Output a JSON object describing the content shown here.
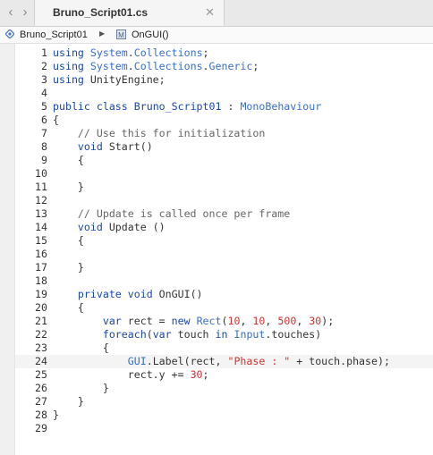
{
  "tab": {
    "title": "Bruno_Script01.cs"
  },
  "jumpbar": {
    "file": "Bruno_Script01",
    "method": "OnGUI()",
    "method_icon": "M"
  },
  "icons": {
    "back": "‹",
    "forward": "›",
    "close": "✕",
    "arrow": "▶"
  },
  "current_line": 24,
  "lines": [
    {
      "n": "1",
      "t": [
        [
          "kw",
          "using"
        ],
        [
          "p",
          " "
        ],
        [
          "typ",
          "System"
        ],
        [
          "p",
          "."
        ],
        [
          "typ",
          "Collections"
        ],
        [
          "p",
          ";"
        ]
      ]
    },
    {
      "n": "2",
      "t": [
        [
          "kw",
          "using"
        ],
        [
          "p",
          " "
        ],
        [
          "typ",
          "System"
        ],
        [
          "p",
          "."
        ],
        [
          "typ",
          "Collections"
        ],
        [
          "p",
          "."
        ],
        [
          "typ",
          "Generic"
        ],
        [
          "p",
          ";"
        ]
      ]
    },
    {
      "n": "3",
      "t": [
        [
          "kw",
          "using"
        ],
        [
          "p",
          " UnityEngine;"
        ]
      ]
    },
    {
      "n": "4",
      "t": []
    },
    {
      "n": "5",
      "t": [
        [
          "kw",
          "public class"
        ],
        [
          "p",
          " "
        ],
        [
          "kw",
          "Bruno_Script01"
        ],
        [
          "p",
          " : "
        ],
        [
          "typ",
          "MonoBehaviour"
        ]
      ]
    },
    {
      "n": "6",
      "t": [
        [
          "p",
          "{"
        ]
      ]
    },
    {
      "n": "7",
      "t": [
        [
          "p",
          "    "
        ],
        [
          "cmt",
          "// Use this for initialization"
        ]
      ]
    },
    {
      "n": "8",
      "t": [
        [
          "p",
          "    "
        ],
        [
          "kw",
          "void"
        ],
        [
          "p",
          " Start()"
        ]
      ]
    },
    {
      "n": "9",
      "t": [
        [
          "p",
          "    {"
        ]
      ]
    },
    {
      "n": "10",
      "t": []
    },
    {
      "n": "11",
      "t": [
        [
          "p",
          "    }"
        ]
      ]
    },
    {
      "n": "12",
      "t": []
    },
    {
      "n": "13",
      "t": [
        [
          "p",
          "    "
        ],
        [
          "cmt",
          "// Update is called once per frame"
        ]
      ]
    },
    {
      "n": "14",
      "t": [
        [
          "p",
          "    "
        ],
        [
          "kw",
          "void"
        ],
        [
          "p",
          " Update ()"
        ]
      ]
    },
    {
      "n": "15",
      "t": [
        [
          "p",
          "    {"
        ]
      ]
    },
    {
      "n": "16",
      "t": []
    },
    {
      "n": "17",
      "t": [
        [
          "p",
          "    }"
        ]
      ]
    },
    {
      "n": "18",
      "t": []
    },
    {
      "n": "19",
      "t": [
        [
          "p",
          "    "
        ],
        [
          "kw",
          "private void"
        ],
        [
          "p",
          " OnGUI()"
        ]
      ]
    },
    {
      "n": "20",
      "t": [
        [
          "p",
          "    {"
        ]
      ]
    },
    {
      "n": "21",
      "t": [
        [
          "p",
          "        "
        ],
        [
          "kw",
          "var"
        ],
        [
          "p",
          " rect = "
        ],
        [
          "kw",
          "new"
        ],
        [
          "p",
          " "
        ],
        [
          "typ",
          "Rect"
        ],
        [
          "p",
          "("
        ],
        [
          "num",
          "10"
        ],
        [
          "p",
          ", "
        ],
        [
          "num",
          "10"
        ],
        [
          "p",
          ", "
        ],
        [
          "num",
          "500"
        ],
        [
          "p",
          ", "
        ],
        [
          "num",
          "30"
        ],
        [
          "p",
          ");"
        ]
      ]
    },
    {
      "n": "22",
      "t": [
        [
          "p",
          "        "
        ],
        [
          "kw",
          "foreach"
        ],
        [
          "p",
          "("
        ],
        [
          "kw",
          "var"
        ],
        [
          "p",
          " touch "
        ],
        [
          "kw",
          "in"
        ],
        [
          "p",
          " "
        ],
        [
          "typ",
          "Input"
        ],
        [
          "p",
          ".touches)"
        ]
      ]
    },
    {
      "n": "23",
      "t": [
        [
          "p",
          "        {"
        ]
      ]
    },
    {
      "n": "24",
      "t": [
        [
          "p",
          "            "
        ],
        [
          "typ",
          "GUI"
        ],
        [
          "p",
          ".Label(rect, "
        ],
        [
          "str",
          "\"Phase : \""
        ],
        [
          "p",
          " + touch.phase);"
        ]
      ]
    },
    {
      "n": "25",
      "t": [
        [
          "p",
          "            rect.y += "
        ],
        [
          "num",
          "30"
        ],
        [
          "p",
          ";"
        ]
      ]
    },
    {
      "n": "26",
      "t": [
        [
          "p",
          "        }"
        ]
      ]
    },
    {
      "n": "27",
      "t": [
        [
          "p",
          "    }"
        ]
      ]
    },
    {
      "n": "28",
      "t": [
        [
          "p",
          "}"
        ]
      ]
    },
    {
      "n": "29",
      "t": []
    }
  ]
}
